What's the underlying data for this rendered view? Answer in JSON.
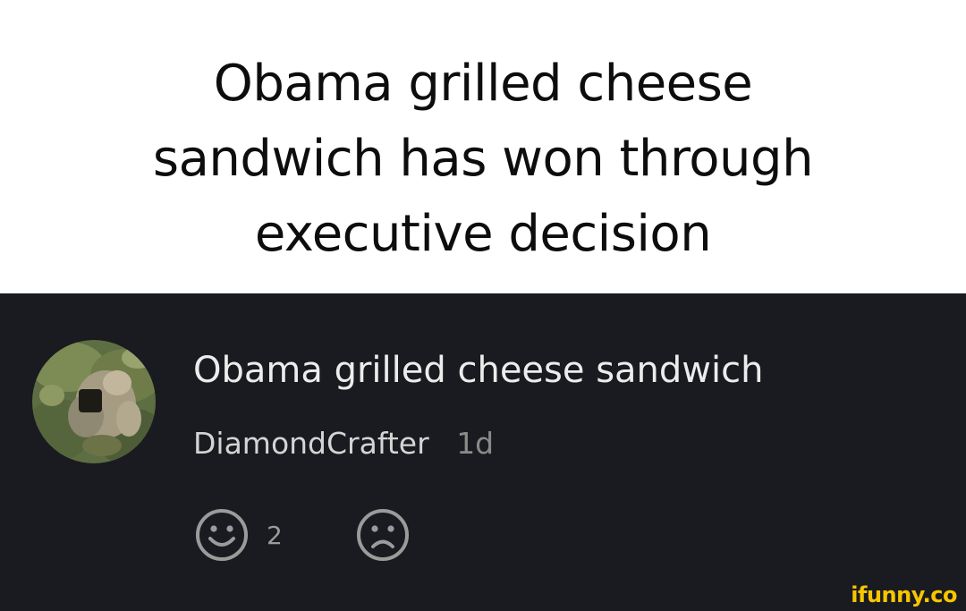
{
  "caption": {
    "lines": [
      "Obama grilled cheese",
      "sandwich has won through",
      "executive decision"
    ]
  },
  "comment": {
    "text": "Obama grilled cheese sandwich",
    "username": "DiamondCrafter",
    "timestamp": "1d",
    "avatar_icon": "avatar-image",
    "reactions": {
      "smile_icon": "smile-icon",
      "smile_count": "2",
      "frown_icon": "frown-icon"
    }
  },
  "watermark": "ifunny.co",
  "colors": {
    "card_background": "#1a1b20",
    "caption_background": "#ffffff",
    "comment_text": "#ececec",
    "username_text": "#d4d4d4",
    "timestamp_text": "#8a8a8a",
    "icon_stroke": "#9b9b9b",
    "watermark": "#f7c600"
  }
}
